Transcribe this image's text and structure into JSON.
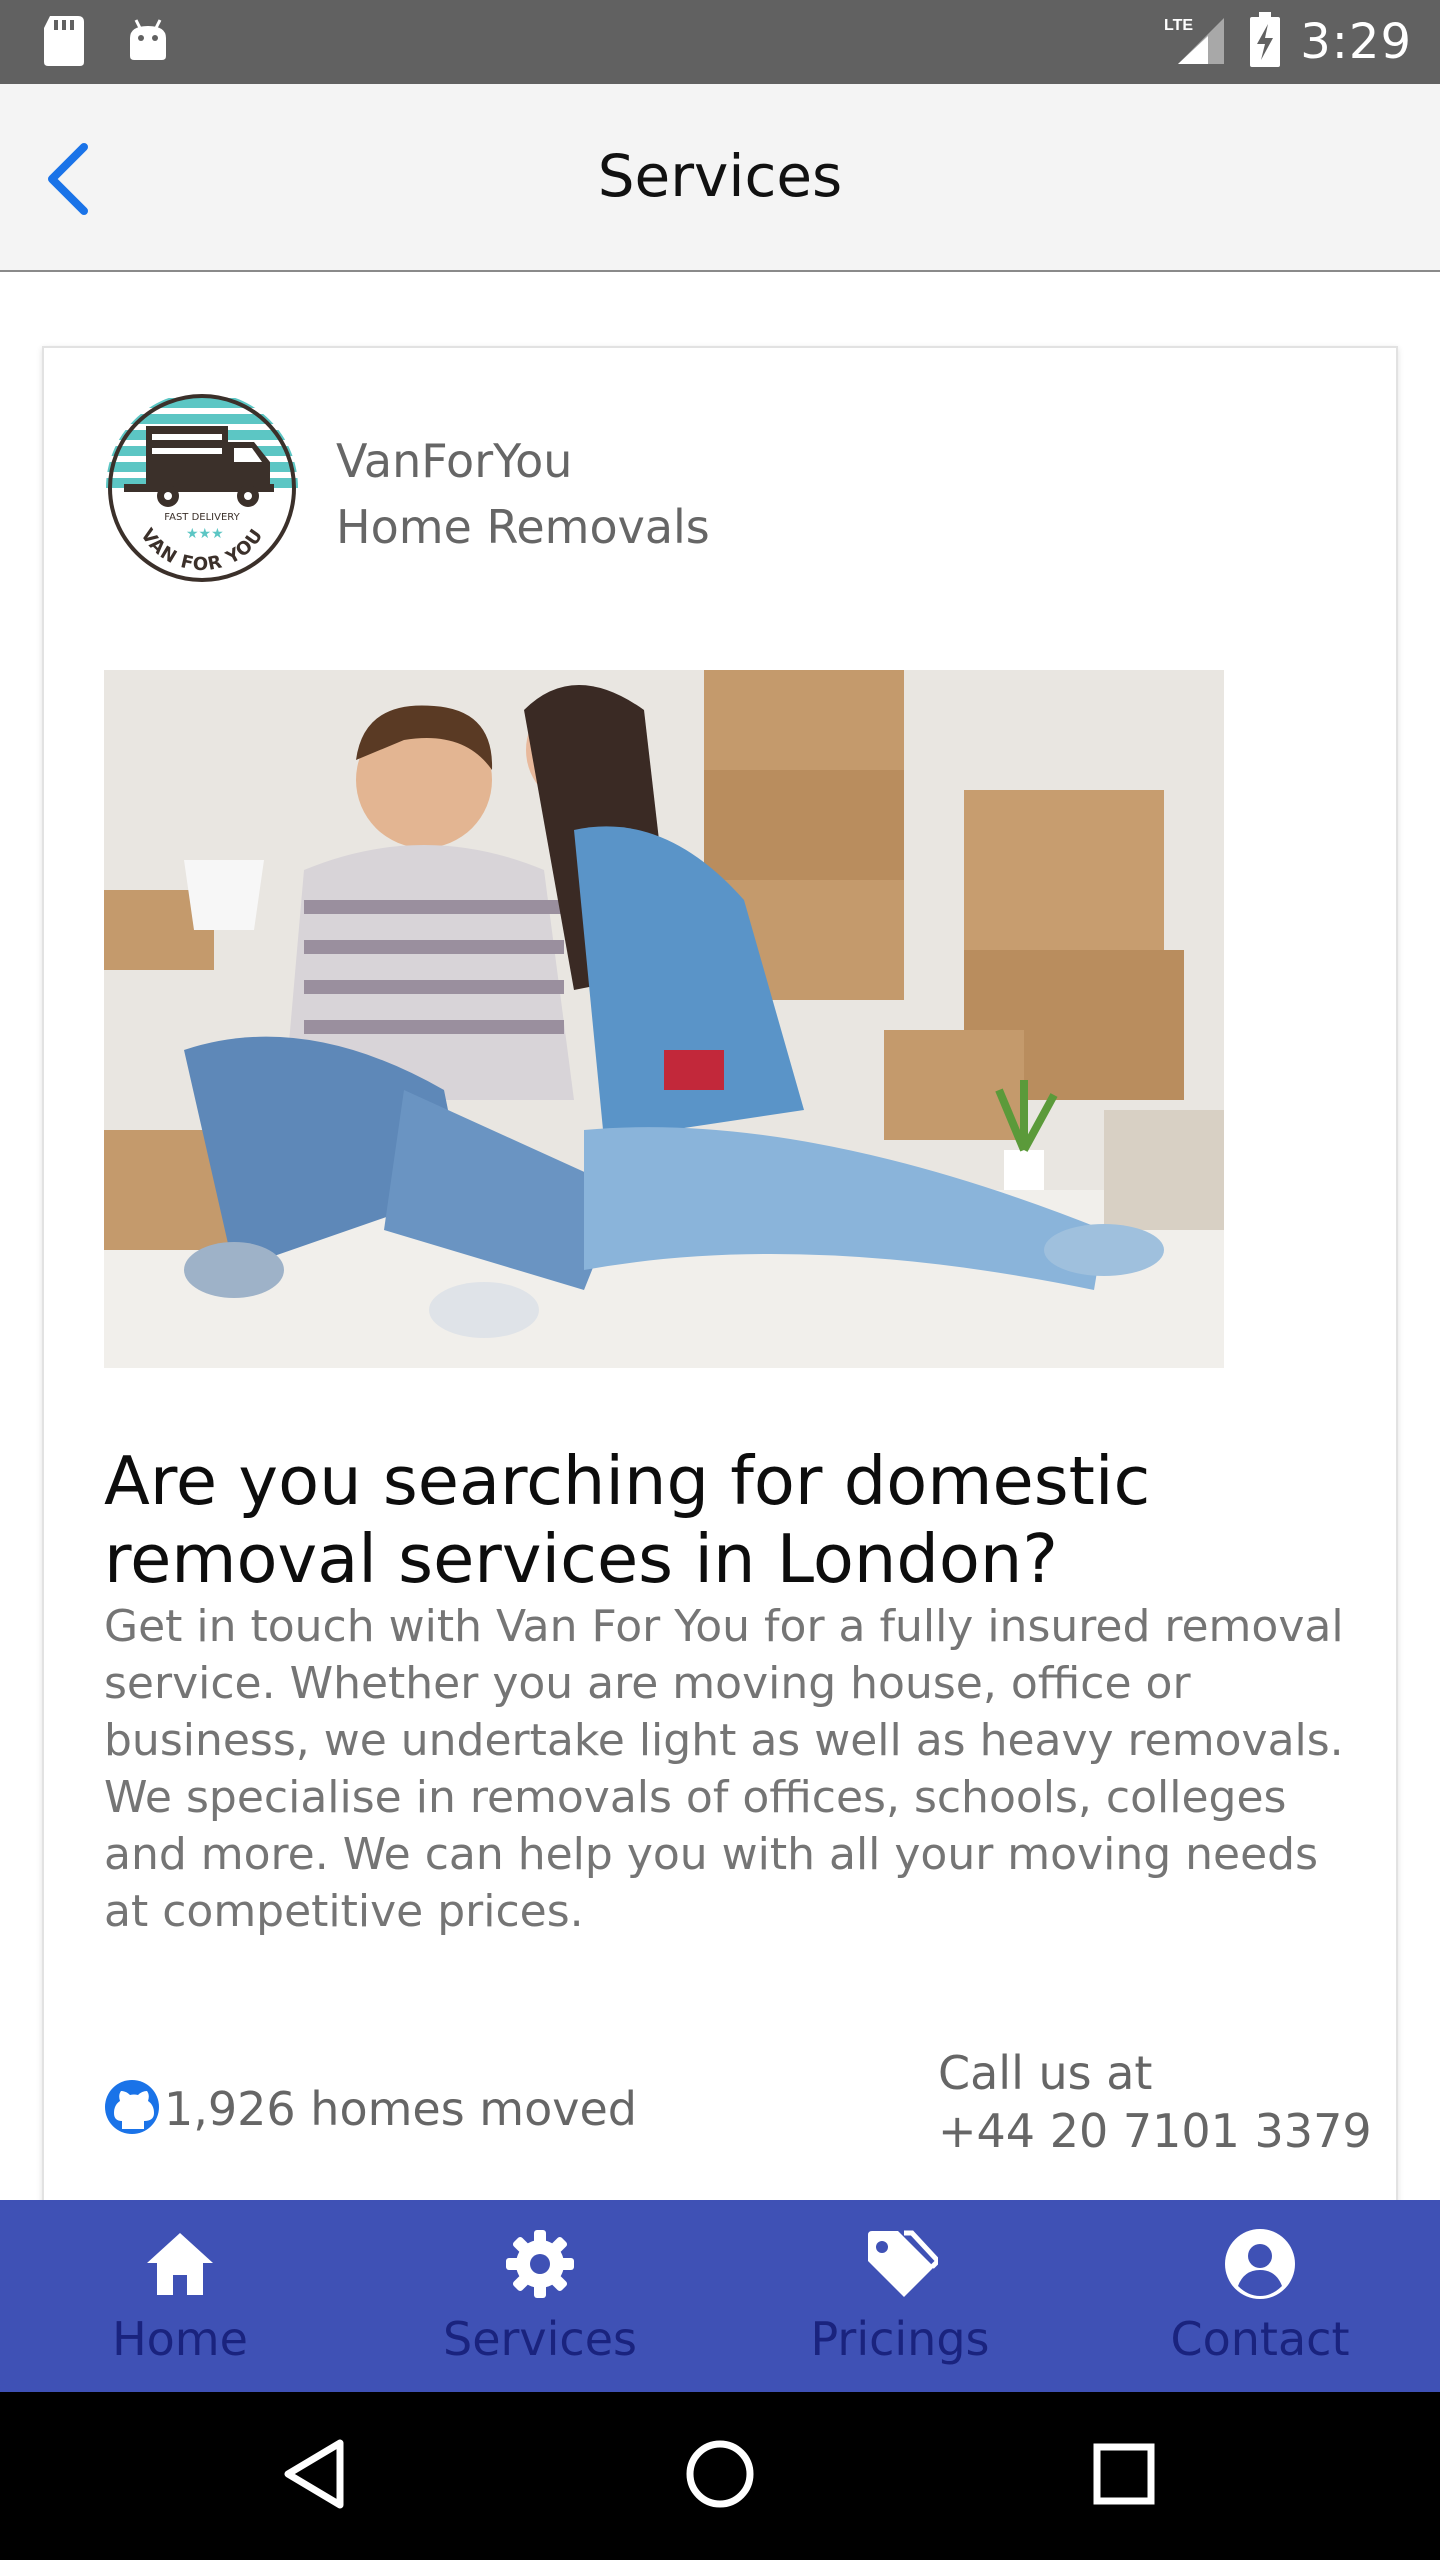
{
  "status_bar": {
    "time": "3:29",
    "network": "LTE",
    "icons": [
      "sd-card-icon",
      "android-icon",
      "lte-signal-icon",
      "battery-charging-icon"
    ]
  },
  "app_bar": {
    "title": "Services",
    "back_icon": "chevron-left-icon"
  },
  "card": {
    "company_name": "VanForYou",
    "company_subtitle": "Home Removals",
    "logo": {
      "top_text": "FAST DELIVERY",
      "bottom_text": "VAN FOR YOU"
    },
    "headline": "Are you searching for domestic removal services in London?",
    "body": "Get in touch with Van For You for a fully insured removal service. Whether you are moving house, office or business, we undertake light as well as heavy removals. We specialise in removals of offices, schools, colleges and more. We can help you with all your moving needs at competitive prices.",
    "stats_icon": "github-icon",
    "stats_text": "1,926 homes moved",
    "call_label": "Call us at",
    "call_number": "+44 20 7101 3379"
  },
  "bottom_nav": {
    "items": [
      {
        "label": "Home",
        "icon": "home-icon"
      },
      {
        "label": "Services",
        "icon": "gear-icon"
      },
      {
        "label": "Pricings",
        "icon": "tags-icon"
      },
      {
        "label": "Contact",
        "icon": "user-circle-icon"
      }
    ],
    "active": "Services",
    "colors": {
      "background": "#3f51b5",
      "icon": "#ffffff",
      "label": "#1a237e"
    }
  },
  "system_nav": {
    "buttons": [
      "back-triangle-icon",
      "home-circle-icon",
      "recents-square-icon"
    ]
  },
  "colors": {
    "status_bar": "#616161",
    "app_bar": "#f4f4f4",
    "accent": "#1a73e8",
    "text_secondary": "#757575"
  }
}
